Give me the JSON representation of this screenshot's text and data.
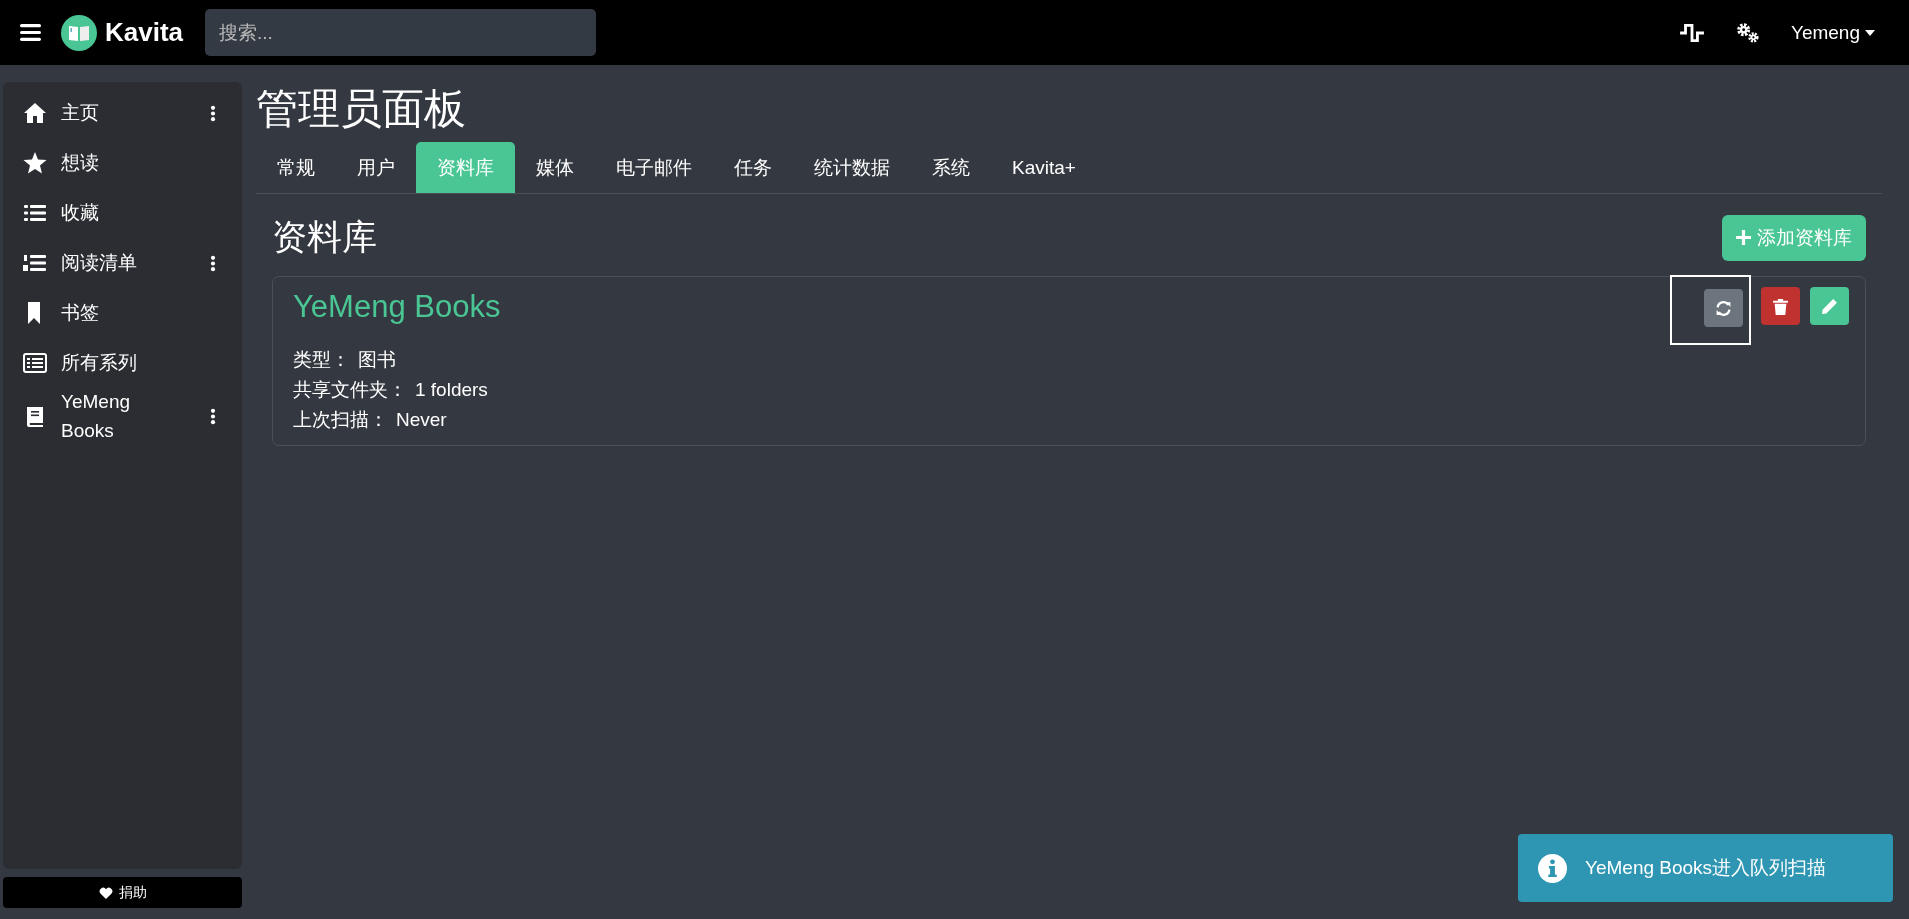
{
  "navbar": {
    "brand": "Kavita",
    "search": {
      "placeholder": "搜索..."
    },
    "user": "Yemeng"
  },
  "sidebar": {
    "items": [
      {
        "label": "主页",
        "menu": true
      },
      {
        "label": "想读",
        "menu": false
      },
      {
        "label": "收藏",
        "menu": false
      },
      {
        "label": "阅读清单",
        "menu": true
      },
      {
        "label": "书签",
        "menu": false
      },
      {
        "label": "所有系列",
        "menu": false
      },
      {
        "label": "YeMeng Books",
        "menu": true
      }
    ],
    "donate": "捐助"
  },
  "page": {
    "title": "管理员面板",
    "tabs": [
      {
        "label": "常规",
        "selected": false
      },
      {
        "label": "用户",
        "selected": false
      },
      {
        "label": "资料库",
        "selected": true
      },
      {
        "label": "媒体",
        "selected": false
      },
      {
        "label": "电子邮件",
        "selected": false
      },
      {
        "label": "任务",
        "selected": false
      },
      {
        "label": "统计数据",
        "selected": false
      },
      {
        "label": "系统",
        "selected": false
      },
      {
        "label": "Kavita+",
        "selected": false
      }
    ],
    "section_title": "资料库",
    "add_button": "添加资料库",
    "libraries": [
      {
        "name": "YeMeng Books",
        "scan_focused": true,
        "fields": [
          {
            "label": "类型：",
            "value": "图书"
          },
          {
            "label": "共享文件夹：",
            "value": "1 folders"
          },
          {
            "label": "上次扫描：",
            "value": "Never"
          }
        ]
      }
    ]
  },
  "toast": {
    "message": "YeMeng Books进入队列扫描"
  }
}
